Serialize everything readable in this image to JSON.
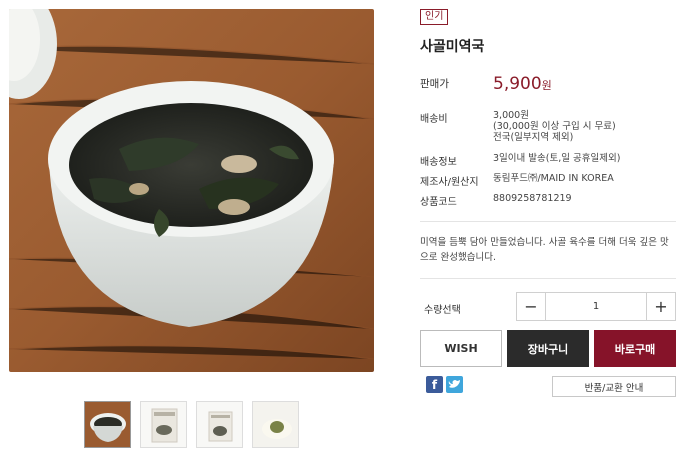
{
  "product": {
    "badge": "인기",
    "title": "사골미역국",
    "price_label": "판매가",
    "price_value": "5,900",
    "price_unit": "원"
  },
  "details": {
    "shipping_label": "배송비",
    "shipping_line1": "3,000원",
    "shipping_line2": "(30,000원 이상 구입 시 무료)",
    "shipping_line3": "전국(일부지역 제외)",
    "delivery_label": "배송정보",
    "delivery_value": "3일이내 발송(토,일 공휴일제외)",
    "maker_label": "제조사/원산지",
    "maker_value": "동림푸드㈜/MAID IN KOREA",
    "code_label": "상품코드",
    "code_value": "8809258781219"
  },
  "description": "미역을 듬뿍 담아 만들었습니다. 사골 육수를 더해 더욱 깊은 맛으로 완성했습니다.",
  "quantity": {
    "label": "수량선택",
    "value": "1",
    "minus": "−",
    "plus": "+"
  },
  "buttons": {
    "wish": "WISH",
    "cart": "장바구니",
    "buy": "바로구매",
    "return_info": "반품/교환 안내"
  },
  "social": {
    "facebook_icon": "facebook-icon",
    "twitter_icon": "twitter-icon"
  },
  "colors": {
    "accent": "#861329",
    "dark": "#2b2b2b"
  }
}
